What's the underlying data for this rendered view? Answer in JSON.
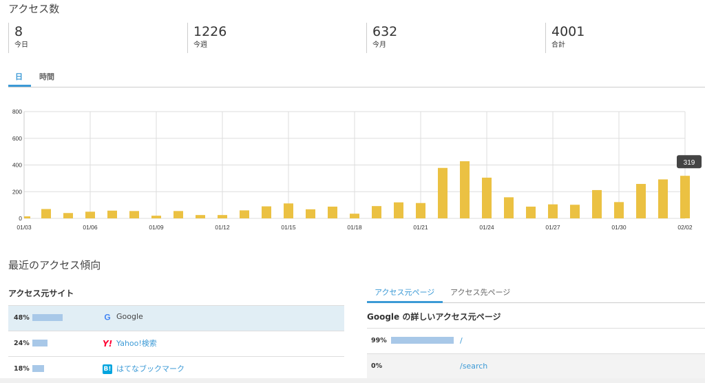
{
  "access_title": "アクセス数",
  "stats": [
    {
      "value": "8",
      "label": "今日"
    },
    {
      "value": "1226",
      "label": "今週"
    },
    {
      "value": "632",
      "label": "今月"
    },
    {
      "value": "4001",
      "label": "合計"
    }
  ],
  "period_tabs": {
    "day": "日",
    "hour": "時間"
  },
  "chart_data": {
    "type": "bar",
    "categories": [
      "01/03",
      "01/04",
      "01/05",
      "01/06",
      "01/07",
      "01/08",
      "01/09",
      "01/10",
      "01/11",
      "01/12",
      "01/13",
      "01/14",
      "01/15",
      "01/16",
      "01/17",
      "01/18",
      "01/19",
      "01/20",
      "01/21",
      "01/22",
      "01/23",
      "01/24",
      "01/25",
      "01/26",
      "01/27",
      "01/28",
      "01/29",
      "01/30",
      "01/31",
      "02/01",
      "02/02"
    ],
    "values": [
      15,
      70,
      40,
      50,
      58,
      55,
      20,
      55,
      25,
      25,
      60,
      90,
      112,
      68,
      88,
      35,
      92,
      120,
      115,
      378,
      428,
      305,
      158,
      88,
      105,
      102,
      212,
      122,
      258,
      292,
      319
    ],
    "x_tick_labels": [
      "01/03",
      "01/06",
      "01/09",
      "01/12",
      "01/15",
      "01/18",
      "01/21",
      "01/24",
      "01/27",
      "01/30",
      "02/02"
    ],
    "y_ticks": [
      0,
      200,
      400,
      600,
      800
    ],
    "ylim": [
      0,
      800
    ],
    "color": "#ebc142",
    "tooltip": "319",
    "title": "",
    "xlabel": "",
    "ylabel": ""
  },
  "trend_title": "最近のアクセス傾向",
  "sources": {
    "heading": "アクセス元サイト",
    "rows": [
      {
        "pct": "48%",
        "fraction": 0.48,
        "site": "Google",
        "icon": "google-icon",
        "color": "#444444"
      },
      {
        "pct": "24%",
        "fraction": 0.24,
        "site": "Yahoo!検索",
        "icon": "yahoo-icon",
        "color": "#3c9ad6"
      },
      {
        "pct": "18%",
        "fraction": 0.18,
        "site": "はてなブックマーク",
        "icon": "hatena-bookmark-icon",
        "color": "#3c9ad6"
      }
    ]
  },
  "page_tabs": {
    "from": "アクセス元ページ",
    "to": "アクセス先ページ"
  },
  "pages": {
    "heading": "Google の詳しいアクセス元ページ",
    "rows": [
      {
        "pct": "99%",
        "fraction": 0.99,
        "path": "/"
      },
      {
        "pct": "0%",
        "fraction": 0.0,
        "path": "/search"
      }
    ]
  },
  "colors": {
    "accent": "#3c9ad6",
    "bar": "#ebc142",
    "highlight_row": "#e1eef5"
  }
}
